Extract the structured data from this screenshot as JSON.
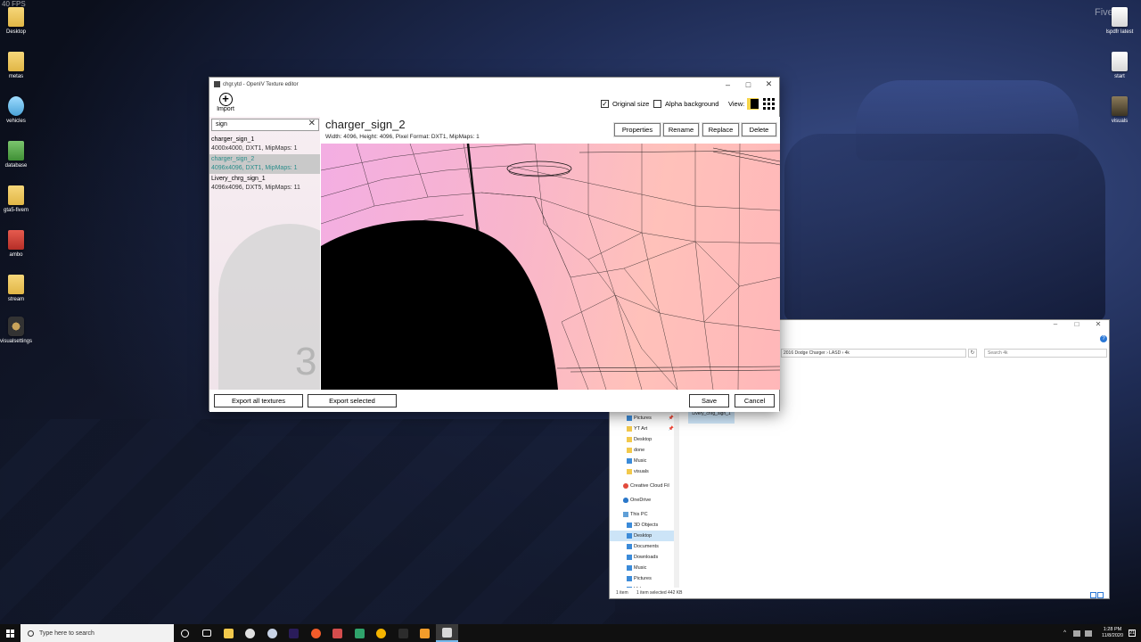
{
  "overlay": {
    "fps_text": "40 FPS",
    "watermark": "FiveM"
  },
  "desktop_icons_left": [
    {
      "label": "Desktop",
      "kind": "folder"
    },
    {
      "label": "metas",
      "kind": "folder"
    },
    {
      "label": "vehicles",
      "kind": "blue"
    },
    {
      "label": "database",
      "kind": "green"
    },
    {
      "label": "gta5-fivem",
      "kind": "folder"
    },
    {
      "label": "ambo",
      "kind": "red"
    },
    {
      "label": "stream",
      "kind": "folder"
    },
    {
      "label": "visualsettings",
      "kind": "dark"
    }
  ],
  "desktop_icons_right": [
    {
      "label": "lspdfr latest",
      "kind": "white"
    },
    {
      "label": "start",
      "kind": "white"
    },
    {
      "label": "visuals",
      "kind": "photo"
    }
  ],
  "oiv": {
    "title": "chgr.ytd - OpenIV Texture editor",
    "import_label": "Import",
    "original_size_label": "Original size",
    "original_size_checked": true,
    "alpha_bg_label": "Alpha background",
    "alpha_bg_checked": false,
    "view_label": "View:",
    "search_value": "sign",
    "textures": [
      {
        "name": "charger_sign_1",
        "meta": "4000x4000, DXT1, MipMaps: 1",
        "selected": false
      },
      {
        "name": "charger_sign_2",
        "meta": "4096x4096, DXT1, MipMaps: 1",
        "selected": true
      },
      {
        "name": "Livery_chrg_sign_1",
        "meta": "4096x4096, DXT5, MipMaps: 11",
        "selected": false
      }
    ],
    "ghost_number": "3",
    "selected_name": "charger_sign_2",
    "selected_meta": "Width: 4096, Height: 4096, Pixel Format: DXT1, MipMaps: 1",
    "buttons": {
      "properties": "Properties",
      "rename": "Rename",
      "replace": "Replace",
      "delete": "Delete",
      "export_all": "Export all textures",
      "export_selected": "Export selected",
      "save": "Save",
      "cancel": "Cancel"
    }
  },
  "explorer": {
    "breadcrumb": "2016 Dodge Charger  ›  LASD  ›  4k",
    "search_placeholder": "Search 4k",
    "nav": [
      {
        "label": "Pictures",
        "kind": "blue",
        "level": "indent",
        "pinned": true
      },
      {
        "label": "YT Art",
        "kind": "folder",
        "level": "indent",
        "pinned": true
      },
      {
        "label": "Desktop",
        "kind": "folder",
        "level": "indent",
        "pinned": false
      },
      {
        "label": "done",
        "kind": "folder",
        "level": "indent",
        "pinned": false
      },
      {
        "label": "Music",
        "kind": "blue",
        "level": "indent",
        "pinned": false
      },
      {
        "label": "visuals",
        "kind": "folder",
        "level": "indent",
        "pinned": false
      },
      {
        "label": "",
        "kind": "spacer",
        "level": "indent",
        "pinned": false
      },
      {
        "label": "Creative Cloud Fil",
        "kind": "cloud",
        "level": "top",
        "pinned": false
      },
      {
        "label": "",
        "kind": "spacer",
        "level": "top",
        "pinned": false
      },
      {
        "label": "OneDrive",
        "kind": "onedrive",
        "level": "top",
        "pinned": false
      },
      {
        "label": "",
        "kind": "spacer",
        "level": "top",
        "pinned": false
      },
      {
        "label": "This PC",
        "kind": "pc",
        "level": "top",
        "pinned": false
      },
      {
        "label": "3D Objects",
        "kind": "blue",
        "level": "indent",
        "pinned": false
      },
      {
        "label": "Desktop",
        "kind": "blue",
        "level": "indent",
        "pinned": false,
        "selected": true
      },
      {
        "label": "Documents",
        "kind": "blue",
        "level": "indent",
        "pinned": false
      },
      {
        "label": "Downloads",
        "kind": "blue",
        "level": "indent",
        "pinned": false
      },
      {
        "label": "Music",
        "kind": "blue",
        "level": "indent",
        "pinned": false
      },
      {
        "label": "Pictures",
        "kind": "blue",
        "level": "indent",
        "pinned": false
      },
      {
        "label": "Videos",
        "kind": "blue",
        "level": "indent",
        "pinned": false
      }
    ],
    "file_label": "Livery_chrg_sign_1",
    "status_count": "1 item",
    "status_selected": "1 item selected  442 KB"
  },
  "taskbar": {
    "search_placeholder": "Type here to search",
    "apps": [
      {
        "name": "cortana-icon",
        "color": "#ffffff"
      },
      {
        "name": "task-view-icon",
        "color": "#ffffff"
      },
      {
        "name": "file-explorer-icon",
        "color": "#f2c94c"
      },
      {
        "name": "rockstar-icon",
        "color": "#e0e0e0"
      },
      {
        "name": "steam-icon",
        "color": "#c8d3e6"
      },
      {
        "name": "premiere-icon",
        "color": "#2a1c5a"
      },
      {
        "name": "origin-icon",
        "color": "#f25c2a"
      },
      {
        "name": "snip-icon",
        "color": "#d34d4d"
      },
      {
        "name": "sheets-icon",
        "color": "#2fa36b"
      },
      {
        "name": "chrome-icon",
        "color": "#f4b400"
      },
      {
        "name": "excel-icon",
        "color": "#2c2c2c"
      },
      {
        "name": "fivem-icon",
        "color": "#f29c2a"
      },
      {
        "name": "openiv-icon",
        "color": "#d8d8d8"
      }
    ],
    "time": "1:28 PM",
    "date": "11/8/2020",
    "notify_count": "21"
  }
}
